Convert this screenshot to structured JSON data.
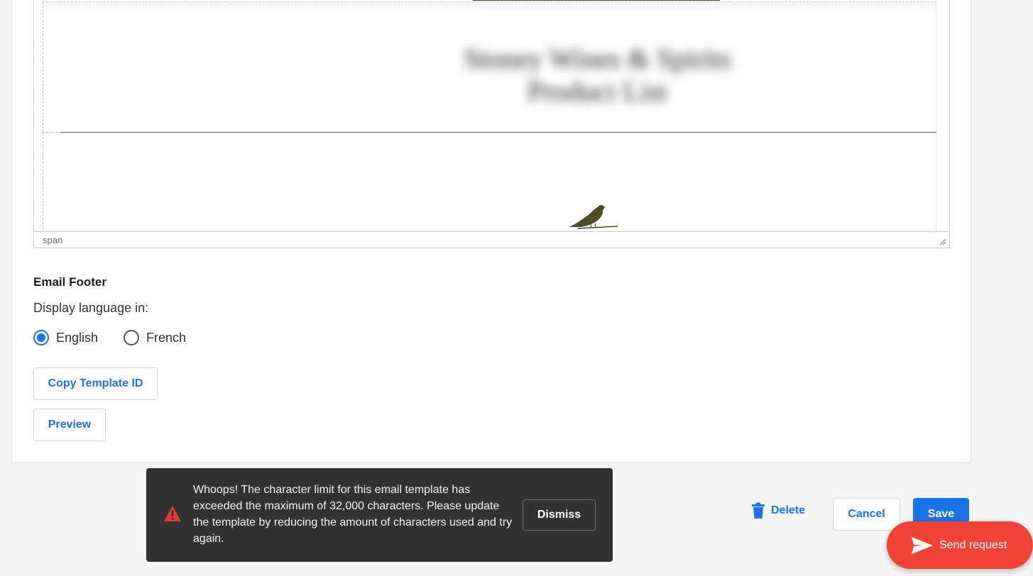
{
  "editor": {
    "statusbar_label": "span",
    "blurred_logo_line1": "Stoney Wines & Spirits",
    "blurred_logo_line2": "Product List"
  },
  "email_footer": {
    "title": "Email Footer",
    "display_language_label": "Display language in:",
    "languages": [
      {
        "label": "English",
        "selected": true
      },
      {
        "label": "French",
        "selected": false
      }
    ]
  },
  "buttons": {
    "copy_template_id": "Copy Template ID",
    "preview": "Preview",
    "delete": "Delete",
    "cancel": "Cancel",
    "save": "Save",
    "send_request": "Send request"
  },
  "toast": {
    "message": "Whoops! The character limit for this email template has exceeded the maximum of 32,000 characters. Please update the template by reducing the amount of characters used and try again.",
    "dismiss_label": "Dismiss",
    "icon": "warning-icon"
  },
  "colors": {
    "accent": "#1a73e8",
    "send_request_bg": "#ef4338",
    "toast_bg": "#323232",
    "warning": "#e53935"
  }
}
